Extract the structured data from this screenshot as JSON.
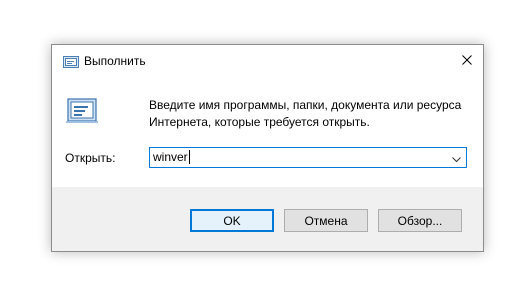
{
  "window": {
    "title": "Выполнить",
    "icon": "run-dialog-icon",
    "close_icon": "close-icon"
  },
  "dialog": {
    "description": "Введите имя программы, папки, документа или ресурса Интернета, которые требуется открыть.",
    "open_label": "Открыть:",
    "input_value": "winver",
    "dropdown_icon": "chevron-down-icon"
  },
  "buttons": {
    "ok": "OK",
    "cancel": "Отмена",
    "browse": "Обзор..."
  },
  "colors": {
    "accent": "#0078d7",
    "footer_bg": "#f0f0f0",
    "button_bg": "#e1e1e1"
  }
}
